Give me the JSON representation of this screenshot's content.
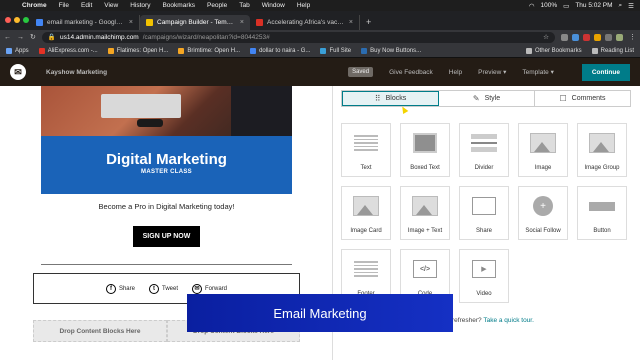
{
  "menubar": {
    "app": "Chrome",
    "items": [
      "File",
      "Edit",
      "View",
      "History",
      "Bookmarks",
      "People",
      "Tab",
      "Window",
      "Help"
    ],
    "battery": "100%",
    "clock": "Thu 5:02 PM"
  },
  "tabs": [
    {
      "title": "email marketing - Google Sea",
      "color": "#4285f4"
    },
    {
      "title": "Campaign Builder - Template",
      "color": "#f2c200"
    },
    {
      "title": "Accelerating Africa's vaccine",
      "color": "#d93025"
    }
  ],
  "address": {
    "host": "us14.admin.mailchimp.com",
    "path": "/campaigns/wizard/neapolitan?id=8044253#"
  },
  "bookmarks": {
    "left": [
      "Apps",
      "AliExpress.com -...",
      "Flatimes: Open H...",
      "Brimtime: Open H...",
      "dollar to naira - G...",
      "Full Site",
      "Buy Now Buttons..."
    ],
    "right": [
      "Other Bookmarks",
      "Reading List"
    ]
  },
  "mc_header": {
    "campaign": "Kayshow Marketing",
    "saved": "Saved",
    "give_feedback": "Give Feedback",
    "help": "Help",
    "preview": "Preview",
    "template": "Template",
    "continue": "Continue"
  },
  "email": {
    "hero_title": "Digital Marketing",
    "hero_subtitle": "MASTER CLASS",
    "tagline": "Become a Pro in Digital Marketing today!",
    "cta": "SIGN UP NOW",
    "social": [
      "Share",
      "Tweet",
      "Forward"
    ],
    "dropzone": "Drop Content Blocks Here",
    "dropzone_right": "Drop Content Blocks Here"
  },
  "panel": {
    "tabs": [
      "Blocks",
      "Style",
      "Comments"
    ],
    "blocks": [
      "Text",
      "Boxed Text",
      "Divider",
      "Image",
      "Image Group",
      "Image Card",
      "Image + Text",
      "Share",
      "Social Follow",
      "Button",
      "Footer",
      "Code",
      "Video"
    ],
    "tour_prefix": "refresher?",
    "tour_link": "Take a quick tour."
  },
  "caption": "Email Marketing"
}
